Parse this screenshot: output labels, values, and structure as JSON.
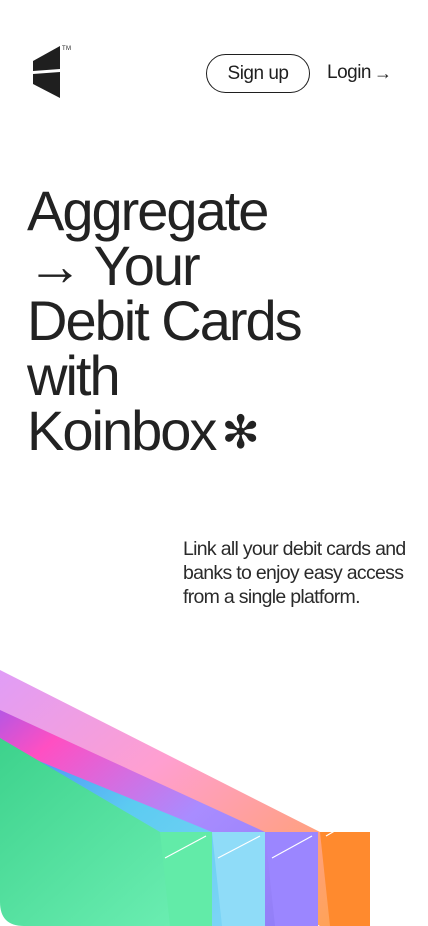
{
  "header": {
    "logo_icon": "koinbox-logo-icon",
    "trademark": "TM",
    "signup_label": "Sign up",
    "login_label": "Login",
    "login_arrow": "→"
  },
  "hero": {
    "line1": "Aggregate",
    "line2": "→ Your",
    "line3": "Debit Cards",
    "line4": "with",
    "line5": "Koinbox",
    "sparkle_icon": "asterisk-sparkle-icon",
    "sparkle_glyph": "✻"
  },
  "description": "Link all your debit cards and banks to enjoy easy access from a single platform.",
  "illustration": {
    "name": "stacked-cards-illustration",
    "colors": [
      "#5ee3a1",
      "#63c7ea",
      "#7f79f2",
      "#ff7a1a"
    ]
  }
}
